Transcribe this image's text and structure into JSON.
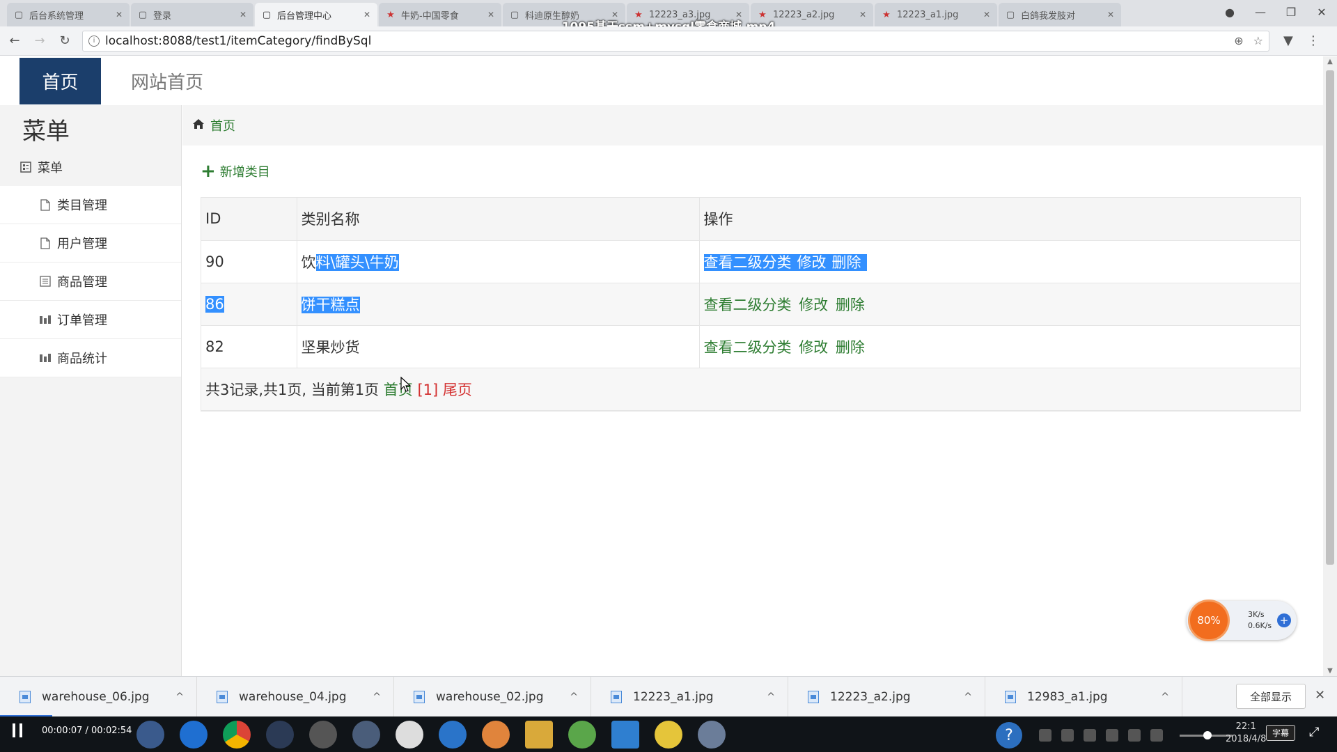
{
  "browser": {
    "tabs": [
      {
        "label": "后台系统管理",
        "active": false
      },
      {
        "label": "登录",
        "active": false
      },
      {
        "label": "后台管理中心",
        "active": true
      },
      {
        "label": "牛奶-中国零食",
        "active": false
      },
      {
        "label": "科迪原生醇奶",
        "active": false
      },
      {
        "label": "12223_a3.jpg",
        "active": false
      },
      {
        "label": "12223_a2.jpg",
        "active": false
      },
      {
        "label": "12223_a1.jpg",
        "active": false
      },
      {
        "label": "白鸽我发肢对",
        "active": false
      }
    ],
    "url": "localhost:8088/test1/itemCategory/findBySql",
    "video_title": "1095基于ssm+mysql零食商城.mp4"
  },
  "topnav": {
    "home": "首页",
    "site_home": "网站首页"
  },
  "sidebar": {
    "title": "菜单",
    "group_label": "菜单",
    "items": [
      {
        "label": "类目管理",
        "icon": "file-icon"
      },
      {
        "label": "用户管理",
        "icon": "file-icon"
      },
      {
        "label": "商品管理",
        "icon": "list-icon"
      },
      {
        "label": "订单管理",
        "icon": "bar-chart-icon"
      },
      {
        "label": "商品统计",
        "icon": "bar-chart-icon"
      }
    ]
  },
  "breadcrumb": {
    "home": "首页"
  },
  "toolbar": {
    "add_label": "新增类目"
  },
  "table": {
    "headers": [
      "ID",
      "类别名称",
      "操作"
    ],
    "rows": [
      {
        "id": "90",
        "name_prefix": "饮",
        "name_selected": "料\\罐头\\牛奶",
        "ops": [
          "查看二级分类",
          "修改",
          "删除"
        ]
      },
      {
        "id": "86",
        "name_prefix": "",
        "name_selected": "饼干糕点",
        "ops": [
          "查看二级分类",
          "修改",
          "删除"
        ]
      },
      {
        "id": "82",
        "name_prefix": "坚果炒货",
        "name_selected": "",
        "ops": [
          "查看二级分类",
          "修改",
          "删除"
        ]
      }
    ],
    "pager": {
      "summary": "共3记录,共1页, 当前第1页",
      "first": "首页",
      "current": "[1]",
      "last": "尾页"
    }
  },
  "speedball": {
    "percent": "80%",
    "up": "3K/s",
    "down": "0.6K/s"
  },
  "downloads": {
    "files": [
      "warehouse_06.jpg",
      "warehouse_04.jpg",
      "warehouse_02.jpg",
      "12223_a1.jpg",
      "12223_a2.jpg",
      "12983_a1.jpg"
    ],
    "show_all": "全部显示"
  },
  "taskbar": {
    "player_time": "00:00:07 / 00:02:54",
    "clock_time": "22:1",
    "clock_date": "2018/4/8",
    "subtitle_btn": "字幕"
  },
  "colors": {
    "nav_active_bg": "#1b3e6b",
    "link_green": "#2e7d32",
    "pager_red": "#d32f2f",
    "selection": "#3390ff"
  }
}
